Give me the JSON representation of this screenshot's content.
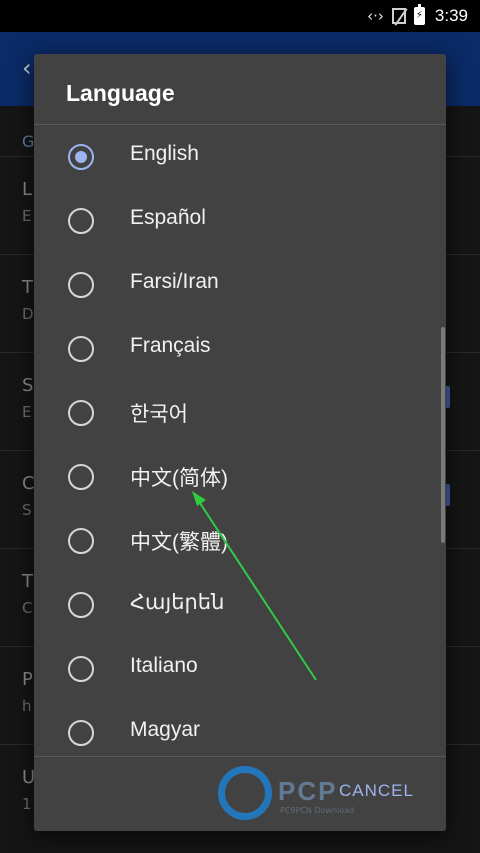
{
  "status_bar": {
    "time": "3:39",
    "icons": [
      "data-sync-icon",
      "no-sim-icon",
      "battery-charging-icon"
    ]
  },
  "dialog": {
    "title": "Language",
    "options": [
      {
        "label": "English",
        "selected": true
      },
      {
        "label": "Español",
        "selected": false
      },
      {
        "label": "Farsi/Iran",
        "selected": false
      },
      {
        "label": "Français",
        "selected": false
      },
      {
        "label": "한국어",
        "selected": false
      },
      {
        "label": "中文(简体)",
        "selected": false
      },
      {
        "label": "中文(繁體)",
        "selected": false
      },
      {
        "label": "Հայերեն",
        "selected": false
      },
      {
        "label": "Italiano",
        "selected": false
      },
      {
        "label": "Magyar",
        "selected": false
      }
    ],
    "cancel_label": "CANCEL"
  },
  "background": {
    "section_letter": "G",
    "items": [
      {
        "title": "L",
        "subtitle": "E"
      },
      {
        "title": "T",
        "subtitle": "D"
      },
      {
        "title": "S",
        "subtitle": "E"
      },
      {
        "title": "C",
        "subtitle": "S"
      },
      {
        "title": "T",
        "subtitle": "C"
      },
      {
        "title": "P",
        "subtitle": "h"
      },
      {
        "title": "U",
        "subtitle": "1"
      }
    ]
  },
  "watermark": {
    "text": "PCP",
    "sub": "PC9PCN Download"
  },
  "colors": {
    "accent": "#9db4f0",
    "dialog_bg": "#424242",
    "app_bar": "#0b2a66",
    "annotation_arrow": "#2ecc40"
  }
}
